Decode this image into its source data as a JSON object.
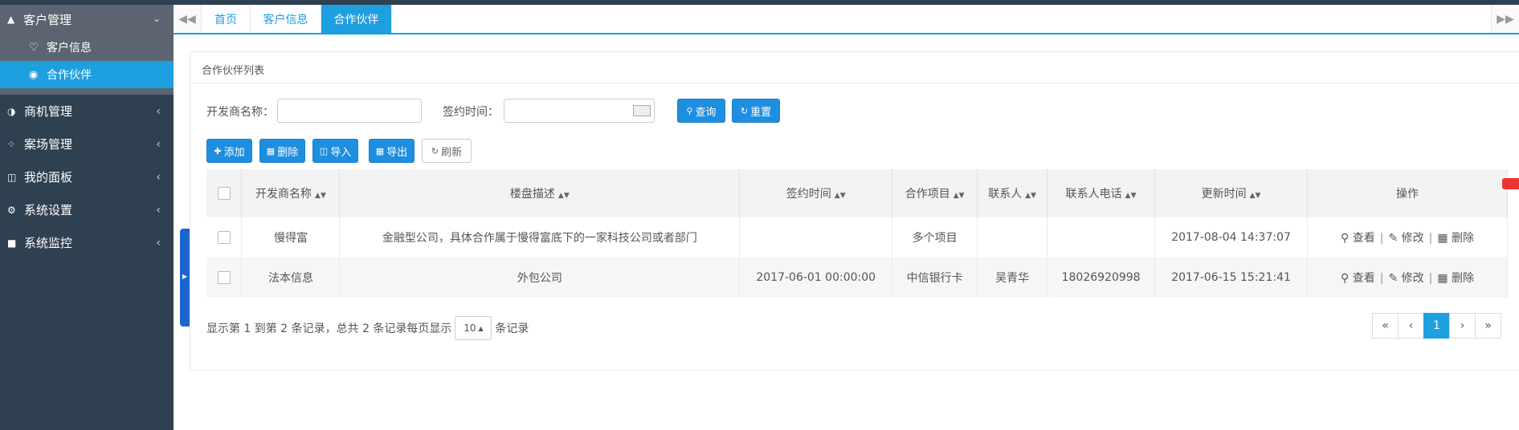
{
  "sidebar": {
    "open_group": {
      "label": "客户管理",
      "icon": "tshirt-icon",
      "items": [
        {
          "label": "客户信息",
          "icon": "heart-icon"
        },
        {
          "label": "合作伙伴",
          "icon": "wechat-icon",
          "active": true
        }
      ]
    },
    "groups": [
      {
        "label": "商机管理",
        "icon": "adjust-icon"
      },
      {
        "label": "案场管理",
        "icon": "spinner-icon"
      },
      {
        "label": "我的面板",
        "icon": "columns-icon"
      },
      {
        "label": "系统设置",
        "icon": "gear-icon"
      },
      {
        "label": "系统监控",
        "icon": "video-icon"
      }
    ]
  },
  "tabs": [
    {
      "label": "首页"
    },
    {
      "label": "客户信息"
    },
    {
      "label": "合作伙伴",
      "active": true
    }
  ],
  "panel": {
    "title": "合作伙伴列表",
    "search": {
      "developer_label": "开发商名称：",
      "developer_value": "",
      "sign_time_label": "签约时间：",
      "sign_time_value": "",
      "query_btn": "查询",
      "reset_btn": "重置"
    },
    "toolbar": {
      "add": "添加",
      "delete": "删除",
      "import": "导入",
      "export": "导出",
      "refresh": "刷新"
    },
    "table": {
      "columns": [
        "开发商名称",
        "楼盘描述",
        "签约时间",
        "合作项目",
        "联系人",
        "联系人电话",
        "更新时间",
        "操作"
      ],
      "rows": [
        {
          "developer": "慢得富",
          "description": "金融型公司，具体合作属于慢得富底下的一家科技公司或者部门",
          "sign_time": "",
          "project": "多个项目",
          "contact": "",
          "phone": "",
          "updated": "2017-08-04 14:37:07"
        },
        {
          "developer": "法本信息",
          "description": "外包公司",
          "sign_time": "2017-06-01 00:00:00",
          "project": "中信银行卡",
          "contact": "吴青华",
          "phone": "18026920998",
          "updated": "2017-06-15 15:21:41"
        }
      ],
      "actions": {
        "view": "查看",
        "edit": "修改",
        "delete": "删除"
      }
    },
    "footer": {
      "summary": "显示第 1 到第 2 条记录，总共 2 条记录每页显示",
      "page_size": "10",
      "suffix": "条记录",
      "current_page": "1"
    }
  },
  "colors": {
    "sidebar_bg": "#2f4050",
    "accent": "#1e9fe0",
    "open_group_bg": "#5b6470"
  }
}
